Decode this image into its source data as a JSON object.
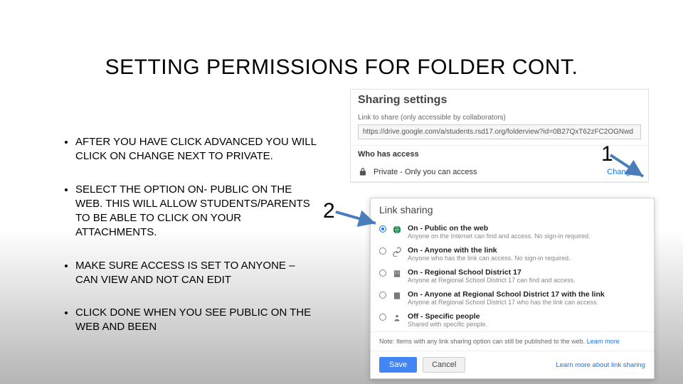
{
  "title": "SETTING PERMISSIONS FOR FOLDER CONT.",
  "bullets": {
    "b1": "AFTER YOU HAVE CLICK ADVANCED YOU WILL CLICK ON CHANGE NEXT TO PRIVATE.",
    "b2": "SELECT THE OPTION ON- PUBLIC ON THE WEB.  THIS WILL ALLOW STUDENTS/PARENTS TO BE ABLE TO CLICK ON YOUR ATTACHMENTS.",
    "b3": "MAKE SURE ACCESS IS SET TO ANYONE – CAN VIEW AND NOT CAN EDIT",
    "b4": "CLICK DONE WHEN YOU SEE PUBLIC ON THE WEB AND BEEN"
  },
  "sharing": {
    "heading": "Sharing settings",
    "linkLabel": "Link to share (only accessible by collaborators)",
    "linkValue": "https://drive.google.com/a/students.rsd17.org/folderview?id=0B27QxT62zFC2OGNwd",
    "whoHeader": "Who has access",
    "privateText": "Private - Only you can access",
    "changeLabel": "Change..."
  },
  "dialog": {
    "title": "Link sharing",
    "options": [
      {
        "main": "On - Public on the web",
        "sub": "Anyone on the Internet can find and access. No sign-in required."
      },
      {
        "main": "On - Anyone with the link",
        "sub": "Anyone who has the link can access. No sign-in required."
      },
      {
        "main": "On - Regional School District 17",
        "sub": "Anyone at Regional School District 17 can find and access."
      },
      {
        "main": "On - Anyone at Regional School District 17 with the link",
        "sub": "Anyone at Regional School District 17 who has the link can access."
      },
      {
        "main": "Off - Specific people",
        "sub": "Shared with specific people."
      }
    ],
    "note": "Note: Items with any link sharing option can still be published to the web. ",
    "noteLink": "Learn more",
    "save": "Save",
    "cancel": "Cancel",
    "footerLink": "Learn more about link sharing"
  },
  "annotations": {
    "a1": "1",
    "a2": "2"
  }
}
